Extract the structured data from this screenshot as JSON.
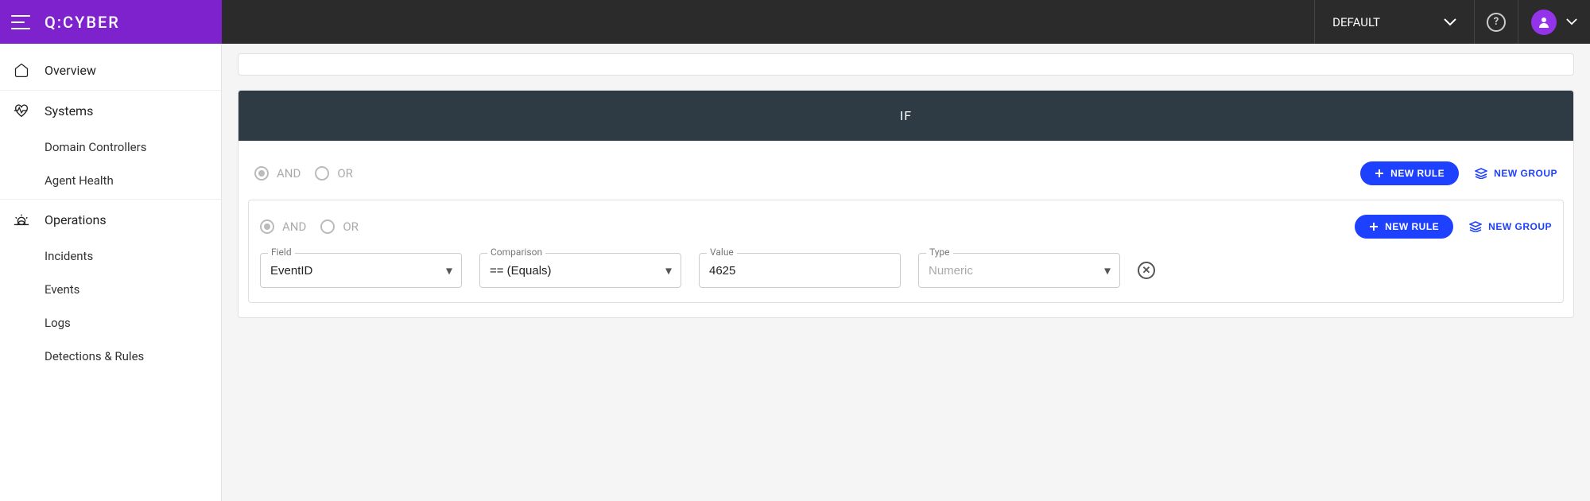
{
  "header": {
    "logo": "Q:CYBER",
    "tenant": "DEFAULT"
  },
  "sidebar": {
    "overview": "Overview",
    "systems": "Systems",
    "domain_controllers": "Domain Controllers",
    "agent_health": "Agent Health",
    "operations": "Operations",
    "incidents": "Incidents",
    "events": "Events",
    "logs": "Logs",
    "detections_rules": "Detections & Rules"
  },
  "condition": {
    "header": "IF",
    "and_label": "AND",
    "or_label": "OR",
    "new_rule": "NEW RULE",
    "new_group": "NEW GROUP",
    "field_label": "Field",
    "field_value": "EventID",
    "comparison_label": "Comparison",
    "comparison_value": "== (Equals)",
    "value_label": "Value",
    "value_value": "4625",
    "type_label": "Type",
    "type_value": "Numeric"
  }
}
